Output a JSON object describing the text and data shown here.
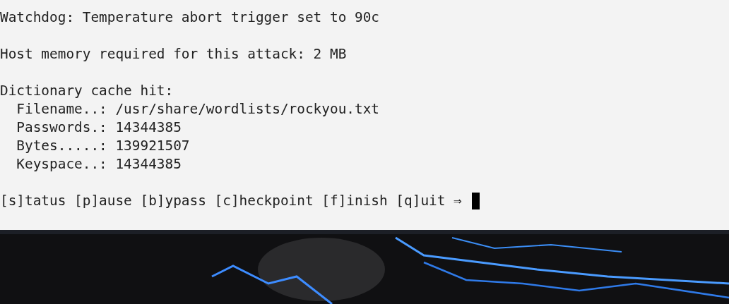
{
  "terminal": {
    "blocks": [
      {
        "lines": [
          {
            "kind": "text",
            "text": "Watchdog: Temperature abort trigger set to 90c"
          }
        ]
      },
      {
        "lines": [
          {
            "kind": "text",
            "text": "Host memory required for this attack: 2 MB"
          }
        ]
      },
      {
        "lines": [
          {
            "kind": "text",
            "text": "Dictionary cache hit:"
          },
          {
            "kind": "bullet",
            "text": "Filename..: /usr/share/wordlists/rockyou.txt"
          },
          {
            "kind": "bullet",
            "text": "Passwords.: 14344385"
          },
          {
            "kind": "bullet",
            "text": "Bytes.....: 139921507"
          },
          {
            "kind": "bullet",
            "text": "Keyspace..: 14344385"
          }
        ]
      }
    ],
    "prompt": "[s]tatus [p]ause [b]ypass [c]heckpoint [f]inish [q]uit ⇒"
  }
}
